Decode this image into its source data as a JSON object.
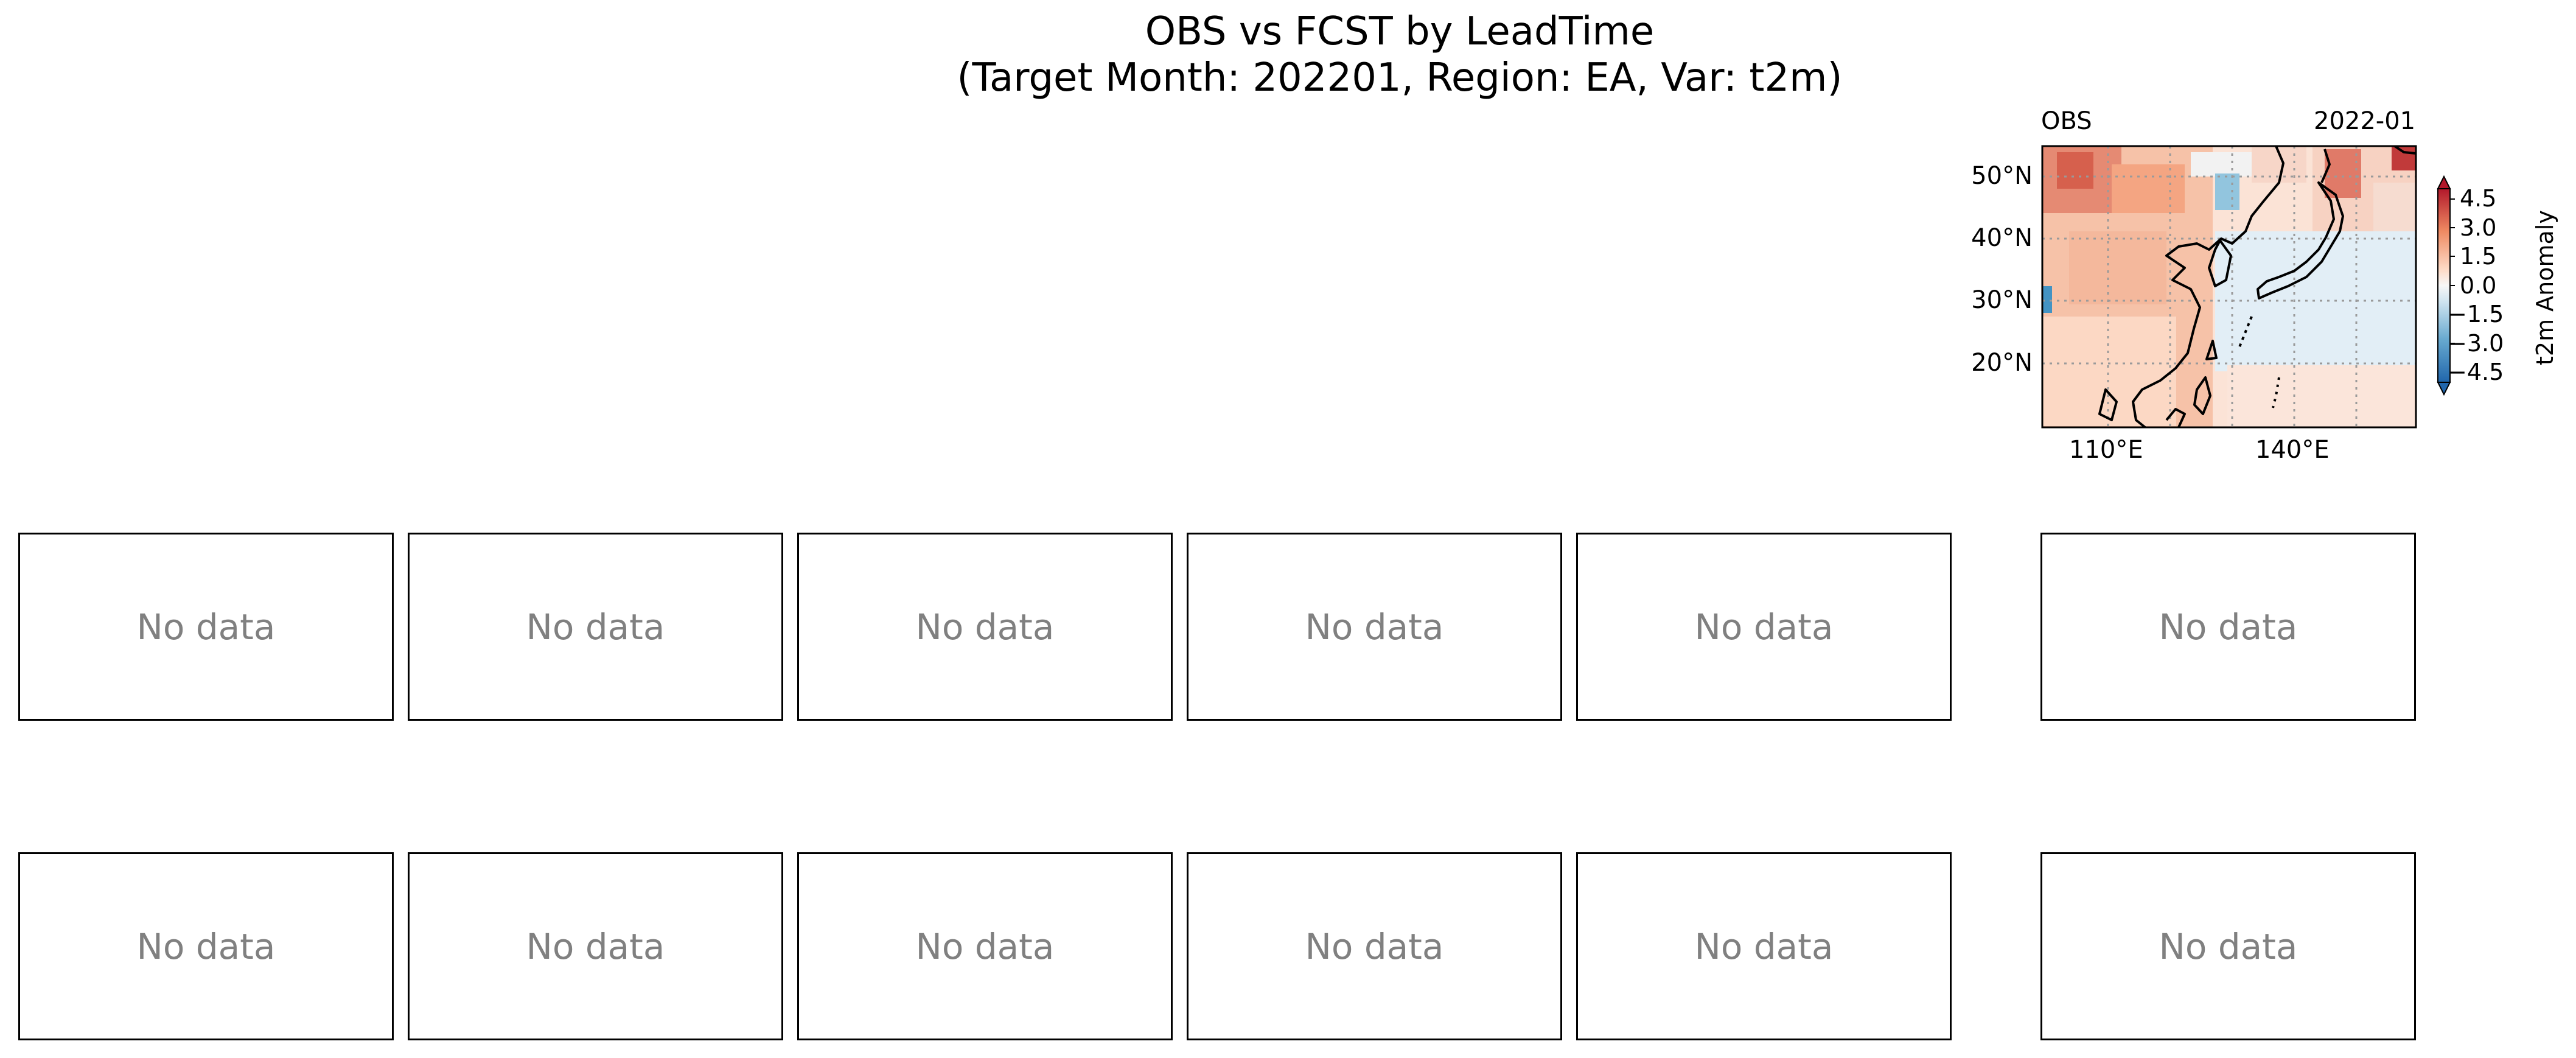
{
  "figure": {
    "title_line1": "OBS vs FCST by LeadTime",
    "title_line2": "(Target Month: 202201, Region: EA, Var: t2m)"
  },
  "obs_panel": {
    "label_left": "OBS",
    "label_right": "2022-01",
    "lat_ticks": [
      "50°N",
      "40°N",
      "30°N",
      "20°N"
    ],
    "lon_ticks": [
      "110°E",
      "140°E"
    ]
  },
  "colorbar": {
    "label": "t2m Anomaly",
    "ticks": [
      "4.5",
      "3.0",
      "1.5",
      "0.0",
      "−1.5",
      "−3.0",
      "−4.5"
    ],
    "colors": {
      "high": "#b2182b",
      "mid": "#f7f7f7",
      "low": "#2166ac"
    }
  },
  "empty_panel_text": "No data",
  "chart_data": {
    "type": "heatmap",
    "title": "OBS vs FCST by LeadTime (Target Month: 202201, Region: EA, Var: t2m)",
    "panels": [
      {
        "row": 0,
        "name": "OBS",
        "date": "2022-01",
        "has_data": true
      },
      {
        "row": 1,
        "count": 6,
        "text": "No data"
      },
      {
        "row": 2,
        "count": 6,
        "text": "No data"
      }
    ],
    "colorbar_range": [
      -5,
      5
    ],
    "colorbar_label": "t2m Anomaly",
    "lat_range": [
      10,
      55
    ],
    "lon_range": [
      100,
      160
    ]
  }
}
